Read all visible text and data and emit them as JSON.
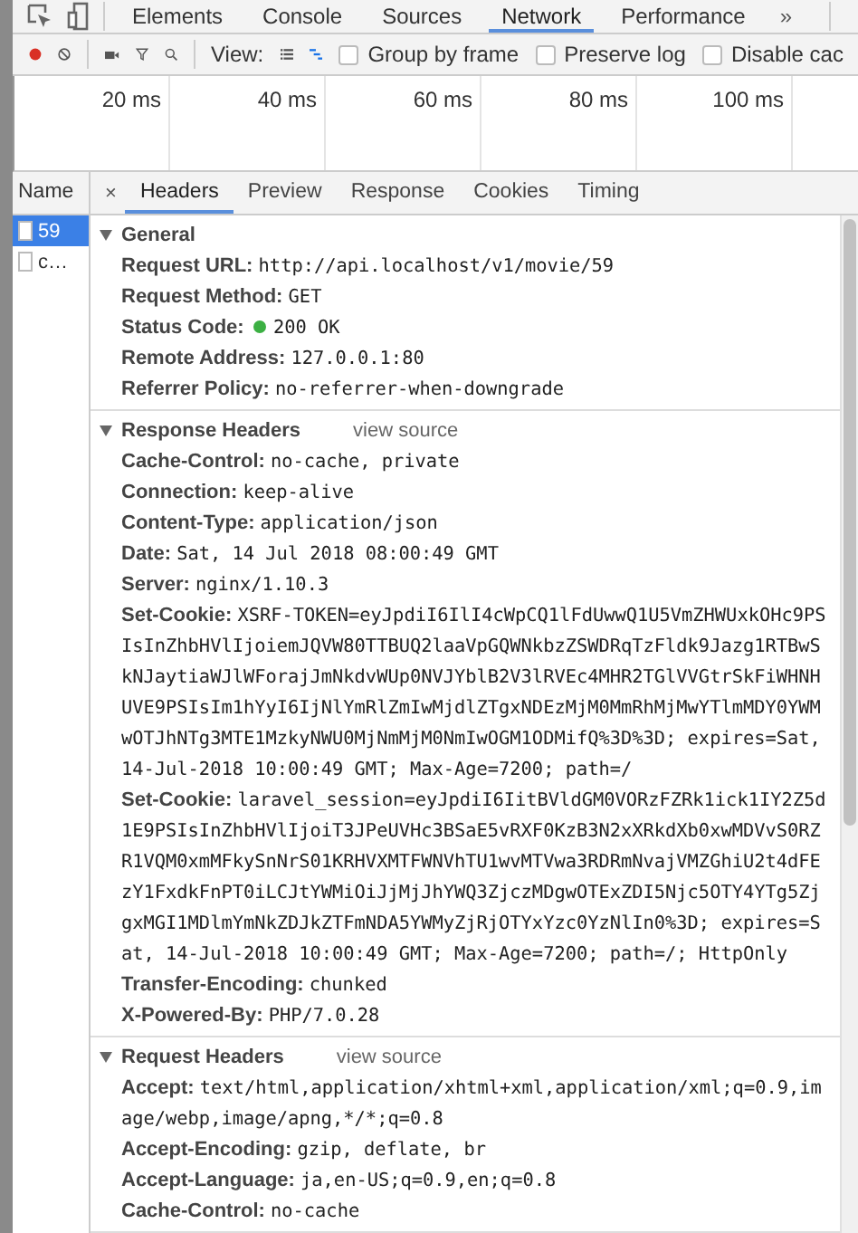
{
  "main_tabs": [
    {
      "label": "Elements",
      "selected": false
    },
    {
      "label": "Console",
      "selected": false
    },
    {
      "label": "Sources",
      "selected": false
    },
    {
      "label": "Network",
      "selected": true
    },
    {
      "label": "Performance",
      "selected": false
    }
  ],
  "more_tabs": "»",
  "toolbar": {
    "recording": true,
    "view_label": "View:",
    "view_modes": [
      {
        "kind": "list",
        "selected": false
      },
      {
        "kind": "waterfall",
        "selected": true
      }
    ],
    "options": [
      {
        "label": "Group by frame",
        "checked": false
      },
      {
        "label": "Preserve log",
        "checked": false
      },
      {
        "label": "Disable cac",
        "checked": false
      }
    ]
  },
  "timeline": {
    "ticks": [
      "20 ms",
      "40 ms",
      "60 ms",
      "80 ms",
      "100 ms"
    ]
  },
  "requests": {
    "header": "Name",
    "items": [
      {
        "name": "59",
        "selected": true
      },
      {
        "name": "c…",
        "selected": false
      }
    ]
  },
  "detail_tabs": {
    "close": "×",
    "tabs": [
      {
        "label": "Headers",
        "selected": true
      },
      {
        "label": "Preview",
        "selected": false
      },
      {
        "label": "Response",
        "selected": false
      },
      {
        "label": "Cookies",
        "selected": false
      },
      {
        "label": "Timing",
        "selected": false
      }
    ]
  },
  "sections": [
    {
      "title": "General",
      "expanded": true,
      "headers": [
        {
          "kind": "plain",
          "name": "Request URL:",
          "value": "http://api.localhost/v1/movie/59"
        },
        {
          "kind": "plain",
          "name": "Request Method:",
          "value": "GET"
        },
        {
          "kind": "status",
          "name": "Status Code:",
          "value": "200 OK"
        },
        {
          "kind": "plain",
          "name": "Remote Address:",
          "value": "127.0.0.1:80"
        },
        {
          "kind": "plain",
          "name": "Referrer Policy:",
          "value": "no-referrer-when-downgrade"
        }
      ]
    },
    {
      "title": "Response Headers",
      "link": "view source",
      "expanded": true,
      "headers": [
        {
          "kind": "plain",
          "name": "Cache-Control:",
          "value": "no-cache, private"
        },
        {
          "kind": "plain",
          "name": "Connection:",
          "value": "keep-alive"
        },
        {
          "kind": "plain",
          "name": "Content-Type:",
          "value": "application/json"
        },
        {
          "kind": "plain",
          "name": "Date:",
          "value": "Sat, 14 Jul 2018 08:00:49 GMT"
        },
        {
          "kind": "plain",
          "name": "Server:",
          "value": "nginx/1.10.3"
        },
        {
          "kind": "plain",
          "name": "Set-Cookie:",
          "value": "XSRF-TOKEN=eyJpdiI6IlI4cWpCQ1lFdUwwQ1U5VmZHWUxkOHc9PSIsInZhbHVlIjoiemJQVW80TTBUQ2laaVpGQWNkbzZSWDRqTzFldk9Jazg1RTBwSkNJaytiaWJlWForajJmNkdvWUp0NVJYblB2V3lRVEc4MHR2TGlVVGtrSkFiWHNHUVE9PSIsIm1hYyI6IjNlYmRlZmIwMjdlZTgxNDEzMjM0MmRhMjMwYTlmMDY0YWMwOTJhNTg3MTE1MzkyNWU0MjNmMjM0NmIwOGM1ODMifQ%3D%3D; expires=Sat, 14-Jul-2018 10:00:49 GMT; Max-Age=7200; path=/"
        },
        {
          "kind": "plain",
          "name": "Set-Cookie:",
          "value": "laravel_session=eyJpdiI6IitBVldGM0VORzFZRk1ick1IY2Z5d1E9PSIsInZhbHVlIjoiT3JPeUVHc3BSaE5vRXF0KzB3N2xXRkdXb0xwMDVvS0RZR1VQM0xmMFkySnNrS01KRHVXMTFWNVhTU1wvMTVwa3RDRmNvajVMZGhiU2t4dFEzY1FxdkFnPT0iLCJtYWMiOiJjMjJhYWQ3ZjczMDgwOTExZDI5Njc5OTY4YTg5ZjgxMGI1MDlmYmNkZDJkZTFmNDA5YWMyZjRjOTYxYzc0YzNlIn0%3D; expires=Sat, 14-Jul-2018 10:00:49 GMT; Max-Age=7200; path=/; HttpOnly"
        },
        {
          "kind": "plain",
          "name": "Transfer-Encoding:",
          "value": "chunked"
        },
        {
          "kind": "plain",
          "name": "X-Powered-By:",
          "value": "PHP/7.0.28"
        }
      ]
    },
    {
      "title": "Request Headers",
      "link": "view source",
      "expanded": true,
      "headers": [
        {
          "kind": "plain",
          "name": "Accept:",
          "value": "text/html,application/xhtml+xml,application/xml;q=0.9,image/webp,image/apng,*/*;q=0.8"
        },
        {
          "kind": "plain",
          "name": "Accept-Encoding:",
          "value": "gzip, deflate, br"
        },
        {
          "kind": "plain",
          "name": "Accept-Language:",
          "value": "ja,en-US;q=0.9,en;q=0.8"
        },
        {
          "kind": "plain",
          "name": "Cache-Control:",
          "value": "no-cache"
        }
      ]
    }
  ]
}
